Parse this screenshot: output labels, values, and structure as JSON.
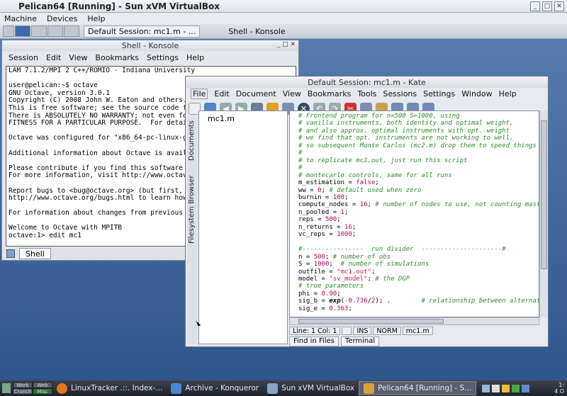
{
  "vbox": {
    "title": "Pelican64 [Running] - Sun xVM VirtualBox",
    "menu": [
      "Machine",
      "Devices",
      "Help"
    ]
  },
  "guest_top": {
    "tasks": [
      "Default Session: mc1.m - ...",
      "Shell - Konsole"
    ]
  },
  "konsole": {
    "title": "Shell - Konsole",
    "menu": [
      "Session",
      "Edit",
      "View",
      "Bookmarks",
      "Settings",
      "Help"
    ],
    "terminal": "LAM 7.1.2/MPI 2 C++/ROMIO - Indiana University\n\nuser@pelican:~$ octave\nGNU Octave, version 3.0.1\nCopyright (C) 2008 John W. Eaton and others.\nThis is free software; see the source code for copy\nThere is ABSOLUTELY NO WARRANTY; not even for MERCH\nFITNESS FOR A PARTICULAR PURPOSE.  For details, typ\n\nOctave was configured for \"x86_64-pc-linux-gnu\".\n\nAdditional information about Octave is available at\n\nPlease contribute if you find this software useful.\nFor more information, visit http://www.octave.org/h\n\nReport bugs to <bug@octave.org> (but first, please \nhttp://www.octave.org/bugs.html to learn how to wri\n\nFor information about changes from previous version\n\nWelcome to Octave with MPITB\noctave:1> edit mc1",
    "tab": "Shell"
  },
  "kate": {
    "title": "Default Session: mc1.m - Kate",
    "menu": [
      "File",
      "Edit",
      "Document",
      "View",
      "Bookmarks",
      "Tools",
      "Sessions",
      "Settings",
      "Window",
      "Help"
    ],
    "side_tabs": [
      "Documents",
      "Filesystem Browser"
    ],
    "files": [
      "mc1.m"
    ],
    "status": [
      "Line: 1 Col: 1",
      "INS",
      "NORM",
      "mc1.m"
    ],
    "bottom_tabs": [
      "Find in Files",
      "Terminal"
    ]
  },
  "taskbar": {
    "pagers": [
      "Work",
      "Web",
      "Crunch",
      "Misc"
    ],
    "items": [
      "LinuxTracker .::. Index-...",
      "Archive - Konqueror",
      "Sun xVM VirtualBox",
      "Pelican64 [Running] - S..."
    ],
    "clock": [
      "1:",
      "4 O"
    ]
  }
}
